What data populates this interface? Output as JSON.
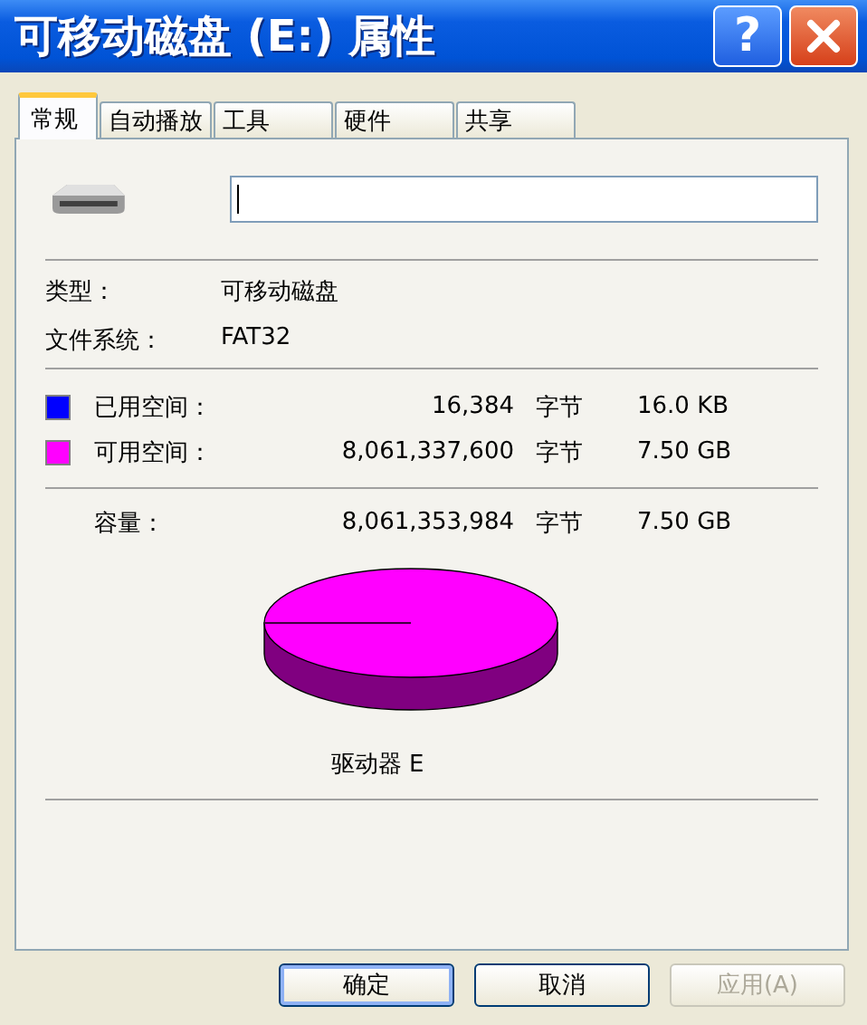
{
  "window": {
    "title": "可移动磁盘 (E:) 属性",
    "help_button": "?"
  },
  "tabs": [
    {
      "label": "常规",
      "selected": true
    },
    {
      "label": "自动播放",
      "selected": false
    },
    {
      "label": "工具",
      "selected": false
    },
    {
      "label": "硬件",
      "selected": false
    },
    {
      "label": "共享",
      "selected": false
    }
  ],
  "info": [
    {
      "label": "类型：",
      "value": "可移动磁盘"
    },
    {
      "label": "文件系统：",
      "value": "FAT32"
    }
  ],
  "space": [
    {
      "label": "已用空间：",
      "bytes": "16,384",
      "unit": "字节",
      "size": "16.0 KB",
      "color": "#0000ff"
    },
    {
      "label": "可用空间：",
      "bytes": "8,061,337,600",
      "unit": "字节",
      "size": "7.50 GB",
      "color": "#ff00ff"
    }
  ],
  "capacity": {
    "label": "容量：",
    "bytes": "8,061,353,984",
    "unit": "字节",
    "size": "7.50 GB"
  },
  "drive_label": "驱动器 E",
  "buttons": [
    {
      "label": "确定",
      "default": true,
      "disabled": false
    },
    {
      "label": "取消",
      "default": false,
      "disabled": false
    },
    {
      "label": "应用(A)",
      "default": false,
      "disabled": true
    }
  ]
}
